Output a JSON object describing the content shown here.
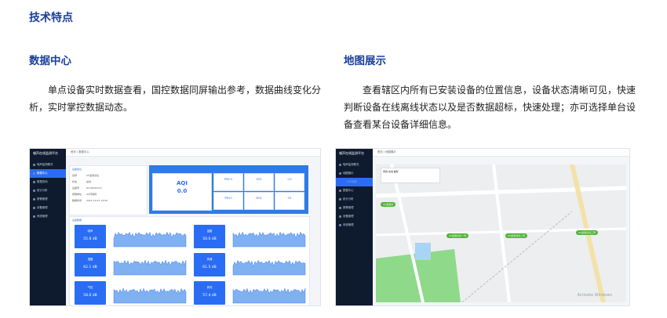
{
  "page": {
    "title": "技术特点",
    "left": {
      "heading": "数据中心",
      "paragraph": "单点设备实时数据查看，国控数据同屏输出参考，数据曲线变化分析，实时掌控数据动态。"
    },
    "right": {
      "heading": "地图展示",
      "paragraph": "查看辖区内所有已安装设备的位置信息，设备状态清晰可见，快速判断设备在线离线状态以及是否数据超标，快速处理；亦可选择单台设备查看某台设备详细信息。"
    }
  },
  "screenshot_left": {
    "app_title": "噪声在线监测平台",
    "breadcrumb": "首页 / 数据中心",
    "tab_label": "数据中心 ×",
    "sidebar": [
      "噪声监测概况",
      "数据中心",
      "数据查询",
      "统计分析",
      "报警管理",
      "设备管理",
      "系统管理"
    ],
    "device_info_title": "设备信息",
    "device_fields": [
      {
        "label": "名称",
        "value": "XX监测点位"
      },
      {
        "label": "状态",
        "value": "在线"
      },
      {
        "label": "设备号",
        "value": "HC19042712"
      },
      {
        "label": "所属单位",
        "value": "XX环保局"
      },
      {
        "label": "数据时间",
        "value": "2021-10-21 14:00"
      }
    ],
    "aqi_label": "AQI",
    "aqi_value": "0.0",
    "pollutants": [
      "PM2.5",
      "SO2",
      "CO",
      "PM10",
      "NO2",
      "O3"
    ],
    "trend_title": "设备数据",
    "tile_labels": [
      "噪声",
      "温度",
      "湿度",
      "风速",
      "气压",
      "风向"
    ],
    "tile_values": [
      "55.8 dB",
      "50.0 dB",
      "62.1 dB",
      "61.5 dB",
      "58.6 dB",
      "57.4 dB"
    ]
  },
  "screenshot_right": {
    "app_title": "噪声在线监测平台",
    "breadcrumb": "首页 / 地图展示",
    "tab_label": "地图展示 ×",
    "sidebar": [
      "噪声监测概况",
      "地图展示",
      "GIS地图",
      "数据中心",
      "统计分析",
      "报警管理",
      "设备管理",
      "系统管理"
    ],
    "legend": "离线 在线 超标",
    "markers": [
      "XX监测点",
      "XX监测点位一号",
      "XX监测点位二号",
      "XX监测点位三号"
    ],
    "watermark": "Activate Windows"
  },
  "colors": {
    "heading": "#1a3f9a",
    "accent": "#2a6df4",
    "sidebar_bg": "#0e1a2e",
    "marker": "#53b33a"
  }
}
